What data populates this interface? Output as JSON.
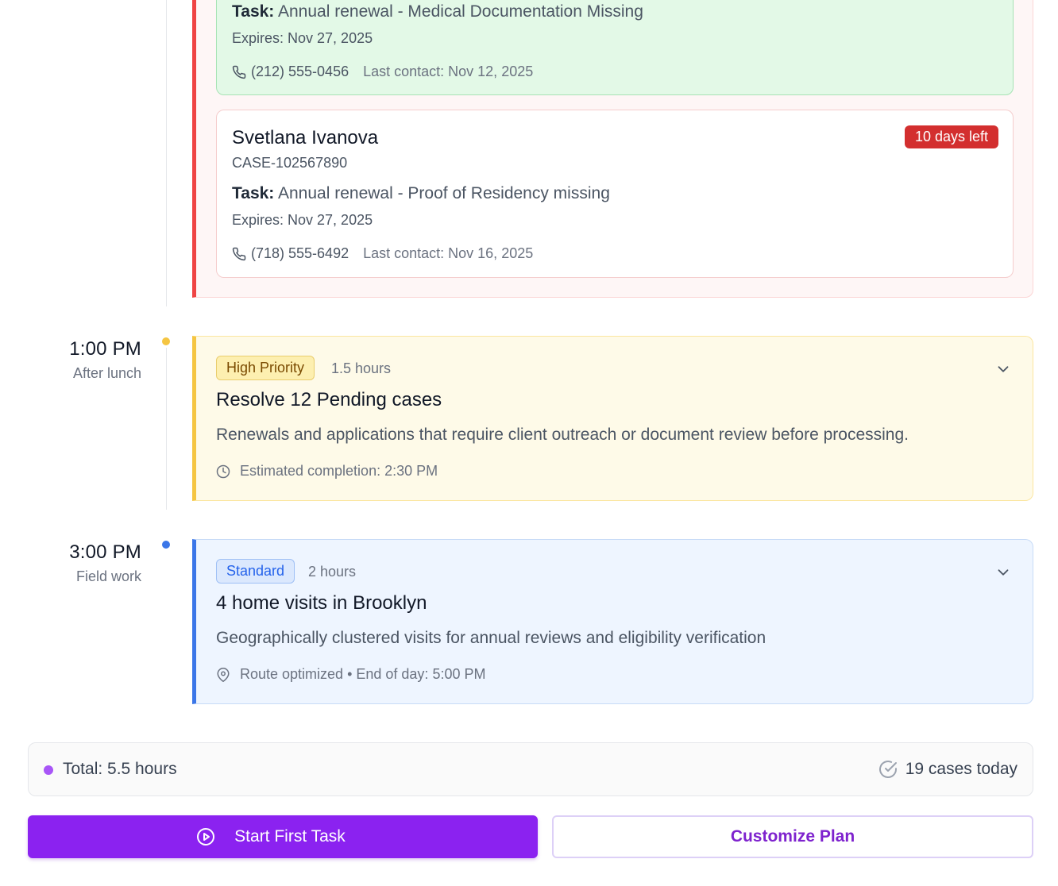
{
  "urgent_cases": [
    {
      "task_label": "Task:",
      "task": "Annual renewal - Medical Documentation Missing",
      "expires": "Expires: Nov 27, 2025",
      "phone": "(212) 555-0456",
      "last_contact": "Last contact: Nov 12, 2025"
    },
    {
      "name": "Svetlana Ivanova",
      "case_id": "CASE-102567890",
      "badge": "10 days left",
      "task_label": "Task:",
      "task": "Annual renewal - Proof of Residency missing",
      "expires": "Expires: Nov 27, 2025",
      "phone": "(718) 555-6492",
      "last_contact": "Last contact: Nov 16, 2025"
    }
  ],
  "slots": [
    {
      "time": "1:00 PM",
      "subtitle": "After lunch",
      "priority": "High Priority",
      "duration": "1.5 hours",
      "title": "Resolve 12 Pending cases",
      "description": "Renewals and applications that require client outreach or document review before processing.",
      "meta": "Estimated completion: 2:30 PM",
      "meta_icon": "clock-icon"
    },
    {
      "time": "3:00 PM",
      "subtitle": "Field work",
      "priority": "Standard",
      "duration": "2 hours",
      "title": "4 home visits in Brooklyn",
      "description": "Geographically clustered visits for annual reviews and eligibility verification",
      "meta": "Route optimized • End of day: 5:00 PM",
      "meta_icon": "map-pin-icon"
    }
  ],
  "summary": {
    "total": "Total: 5.5 hours",
    "cases": "19 cases today"
  },
  "actions": {
    "start": "Start First Task",
    "customize": "Customize Plan"
  },
  "colors": {
    "urgent": "#ef4444",
    "high_priority": "#f5c542",
    "standard": "#3b76e8",
    "primary": "#8b22f0"
  }
}
